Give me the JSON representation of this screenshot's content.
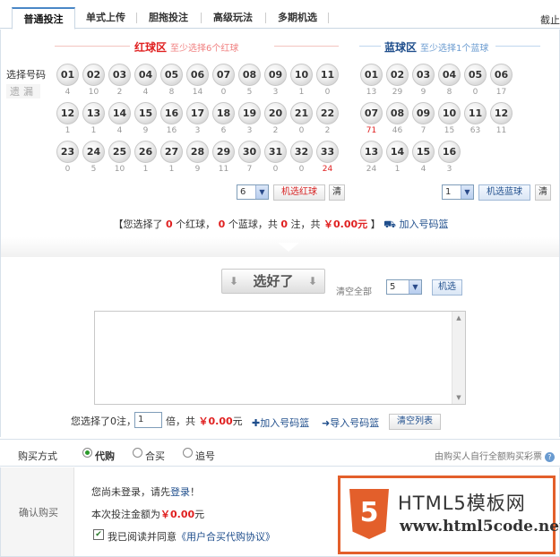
{
  "tabs": [
    {
      "label": "普通投注",
      "active": true
    },
    {
      "label": "单式上传",
      "active": false
    },
    {
      "label": "胆拖投注",
      "active": false
    },
    {
      "label": "高级玩法",
      "active": false
    },
    {
      "label": "多期机选",
      "active": false
    }
  ],
  "tab_right": "截止",
  "red_zone": {
    "title": "红球区",
    "hint": "至少选择6个红球",
    "color": "#e02020"
  },
  "blue_zone": {
    "title": "蓝球区",
    "hint": "至少选择1个蓝球",
    "color": "#1f4e8c"
  },
  "row_labels": {
    "select": "选择号码",
    "miss": "遗漏"
  },
  "red_balls": [
    {
      "n": "01",
      "m": "4"
    },
    {
      "n": "02",
      "m": "10"
    },
    {
      "n": "03",
      "m": "2"
    },
    {
      "n": "04",
      "m": "4"
    },
    {
      "n": "05",
      "m": "8"
    },
    {
      "n": "06",
      "m": "14"
    },
    {
      "n": "07",
      "m": "0"
    },
    {
      "n": "08",
      "m": "5"
    },
    {
      "n": "09",
      "m": "3"
    },
    {
      "n": "10",
      "m": "1"
    },
    {
      "n": "11",
      "m": "0"
    },
    {
      "n": "12",
      "m": "1"
    },
    {
      "n": "13",
      "m": "1"
    },
    {
      "n": "14",
      "m": "4"
    },
    {
      "n": "15",
      "m": "9"
    },
    {
      "n": "16",
      "m": "16"
    },
    {
      "n": "17",
      "m": "3"
    },
    {
      "n": "18",
      "m": "6"
    },
    {
      "n": "19",
      "m": "3"
    },
    {
      "n": "20",
      "m": "2"
    },
    {
      "n": "21",
      "m": "0"
    },
    {
      "n": "22",
      "m": "2"
    },
    {
      "n": "23",
      "m": "0"
    },
    {
      "n": "24",
      "m": "5"
    },
    {
      "n": "25",
      "m": "10"
    },
    {
      "n": "26",
      "m": "1"
    },
    {
      "n": "27",
      "m": "1"
    },
    {
      "n": "28",
      "m": "9"
    },
    {
      "n": "29",
      "m": "11"
    },
    {
      "n": "30",
      "m": "7"
    },
    {
      "n": "31",
      "m": "0"
    },
    {
      "n": "32",
      "m": "0"
    },
    {
      "n": "33",
      "m": "24",
      "hot": true
    }
  ],
  "blue_balls": [
    {
      "n": "01",
      "m": "13"
    },
    {
      "n": "02",
      "m": "29"
    },
    {
      "n": "03",
      "m": "9"
    },
    {
      "n": "04",
      "m": "8"
    },
    {
      "n": "05",
      "m": "0"
    },
    {
      "n": "06",
      "m": "17"
    },
    {
      "n": "07",
      "m": "71",
      "hot": true
    },
    {
      "n": "08",
      "m": "46"
    },
    {
      "n": "09",
      "m": "7"
    },
    {
      "n": "10",
      "m": "15"
    },
    {
      "n": "11",
      "m": "63"
    },
    {
      "n": "12",
      "m": "11"
    },
    {
      "n": "13",
      "m": "24"
    },
    {
      "n": "14",
      "m": "1"
    },
    {
      "n": "15",
      "m": "4"
    },
    {
      "n": "16",
      "m": "3"
    }
  ],
  "red_controls": {
    "count": "6",
    "random_label": "机选红球",
    "clear_label": "清"
  },
  "blue_controls": {
    "count": "1",
    "random_label": "机选蓝球",
    "clear_label": "清"
  },
  "summary": {
    "p1": "【您选择了",
    "red_count": "0",
    "p2": "个红球，",
    "blue_count": "0",
    "p3": "个蓝球，共",
    "bets": "0",
    "p4": "注，共",
    "amount": "￥0.00元",
    "p5": "】",
    "basket": "加入号码篮"
  },
  "done_button": "选好了",
  "clear_all": "清空全部",
  "random_count": "5",
  "random_button": "机选",
  "bottom": {
    "selected_prefix": "您选择了0注，",
    "multiple": "1",
    "multiple_label": "倍，共",
    "amount": "￥0.00",
    "amount_unit": "元",
    "add_basket": "加入号码篮",
    "import_basket": "导入号码篮",
    "clear_list": "清空列表"
  },
  "buy": {
    "label": "购买方式",
    "options": [
      "代购",
      "合买",
      "追号"
    ],
    "selected": 0,
    "note": "由购买人自行全额购买彩票"
  },
  "confirm": {
    "label": "确认购买",
    "login_prefix": "您尚未登录，请先",
    "login_link": "登录",
    "login_suffix": "！",
    "amount_prefix": "本次投注金额为",
    "amount": "￥0.00",
    "amount_unit": "元",
    "agree_prefix": "我已阅读并同意",
    "agree_link": "《用户合买代购协议》"
  },
  "watermark": {
    "title": "HTML5模板网",
    "url": "www.html5code.net",
    "shield": "5"
  }
}
